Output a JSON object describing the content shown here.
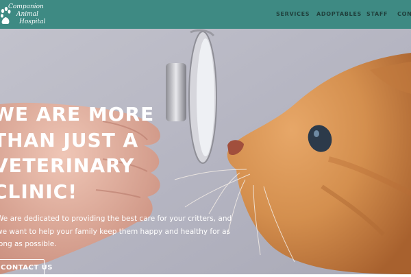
{
  "brand": {
    "line1": "Companion",
    "line2": "Animal",
    "line3": "Hospital"
  },
  "nav": {
    "items": [
      "SERVICES",
      "ADOPTABLES",
      "STAFF",
      "CONTACT"
    ]
  },
  "hero": {
    "headline": [
      "WE ARE MORE",
      "THAN JUST A",
      "VETERINARY",
      "CLINIC!"
    ],
    "subtext": [
      "We are dedicated to providing the best care for your critters, and",
      "we want to help your family keep them happy and healthy for as",
      "long as possible."
    ],
    "cta_label": "CONTACT US"
  },
  "colors": {
    "header_bg": "#3e8a83",
    "nav_text": "#1f3f3b",
    "hero_text": "#ffffff"
  },
  "icons": {
    "logo": "paw-print-icon"
  }
}
